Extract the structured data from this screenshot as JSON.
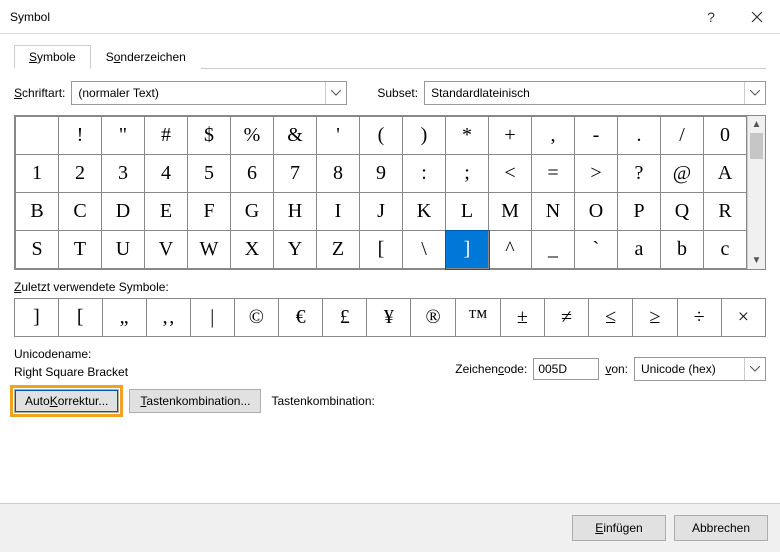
{
  "window": {
    "title": "Symbol"
  },
  "tabs": {
    "symbols": "Symbole",
    "special": "Sonderzeichen"
  },
  "font": {
    "label": "Schriftart:",
    "value": "(normaler Text)"
  },
  "subset": {
    "label": "Subset:",
    "value": "Standardlateinisch"
  },
  "grid": {
    "rows": [
      [
        "",
        "!",
        "\"",
        "#",
        "$",
        "%",
        "&",
        "'",
        "(",
        ")",
        "*",
        "+",
        ",",
        "-",
        ".",
        "/",
        "0"
      ],
      [
        "1",
        "2",
        "3",
        "4",
        "5",
        "6",
        "7",
        "8",
        "9",
        ":",
        ";",
        "<",
        "=",
        ">",
        "?",
        "@",
        "A"
      ],
      [
        "B",
        "C",
        "D",
        "E",
        "F",
        "G",
        "H",
        "I",
        "J",
        "K",
        "L",
        "M",
        "N",
        "O",
        "P",
        "Q",
        "R"
      ],
      [
        "S",
        "T",
        "U",
        "V",
        "W",
        "X",
        "Y",
        "Z",
        "[",
        "\\",
        "]",
        "^",
        "_",
        "`",
        "a",
        "b",
        "c"
      ]
    ],
    "selected": {
      "row": 3,
      "col": 10
    }
  },
  "recent": {
    "label": "Zuletzt verwendete Symbole:",
    "items": [
      "]",
      "[",
      "„",
      "‚‚",
      "|",
      "©",
      "€",
      "£",
      "¥",
      "®",
      "™",
      "±",
      "≠",
      "≤",
      "≥",
      "÷",
      "×"
    ]
  },
  "unicodename": {
    "label": "Unicodename:",
    "value": "Right Square Bracket"
  },
  "charcode": {
    "label": "Zeichencode:",
    "value": "005D"
  },
  "from": {
    "label": "von:",
    "value": "Unicode (hex)"
  },
  "buttons": {
    "autocorrect": "AutoKorrektur...",
    "shortcut": "Tastenkombination...",
    "shortcut_label": "Tastenkombination:",
    "insert": "Einfügen",
    "cancel": "Abbrechen"
  }
}
